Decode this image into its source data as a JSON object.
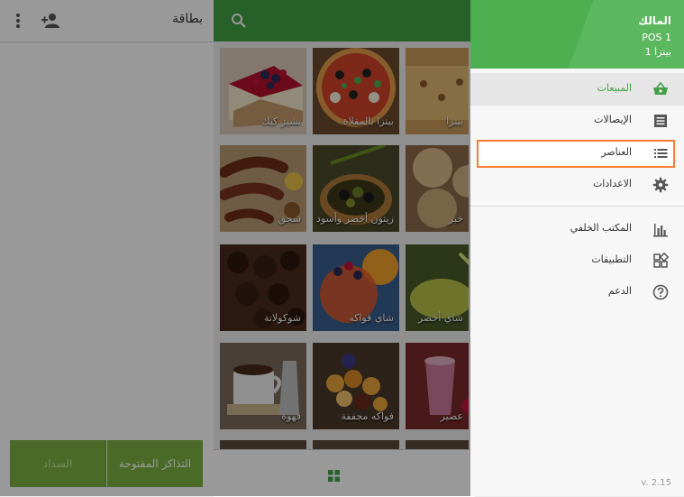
{
  "ticket": {
    "title": "بطاقة",
    "open_tickets_label": "التذاكر المفتوحة",
    "charge_label": "السداد"
  },
  "items": [
    {
      "label": "تشيز كيك",
      "icon": "cheesecake-photo"
    },
    {
      "label": "بيتزا بالمقلاة",
      "icon": "pan-pizza-photo"
    },
    {
      "label": "بيتزا",
      "icon": "pizza-photo"
    },
    {
      "label": "سجق",
      "icon": "sausage-photo"
    },
    {
      "label": "زيتون أخضر وأسود",
      "icon": "olives-photo"
    },
    {
      "label": "خبز",
      "icon": "bread-photo"
    },
    {
      "label": "شوكولاتة",
      "icon": "chocolate-photo"
    },
    {
      "label": "شاي فواكه",
      "icon": "fruit-tea-photo"
    },
    {
      "label": "شاي أخضر",
      "icon": "green-tea-photo"
    },
    {
      "label": "قهوة",
      "icon": "coffee-photo"
    },
    {
      "label": "فواكه مجففة",
      "icon": "dried-fruit-photo"
    },
    {
      "label": "عصير",
      "icon": "juice-photo"
    }
  ],
  "drawer": {
    "owner": "المالك",
    "pos": "POS 1",
    "store": "بيتزا 1",
    "nav": {
      "sales": "المبيعات",
      "receipts": "الإيصالات",
      "items": "العناصر",
      "settings": "الاعدادات",
      "backoffice": "المكتب الخلفي",
      "apps": "التطبيقات",
      "support": "الدعم"
    },
    "version": "v. 2.15"
  },
  "colors": {
    "primary": "#43a047",
    "drawer_header": "#4caf50",
    "button": "#7cb342",
    "highlight": "#ff7a33"
  }
}
